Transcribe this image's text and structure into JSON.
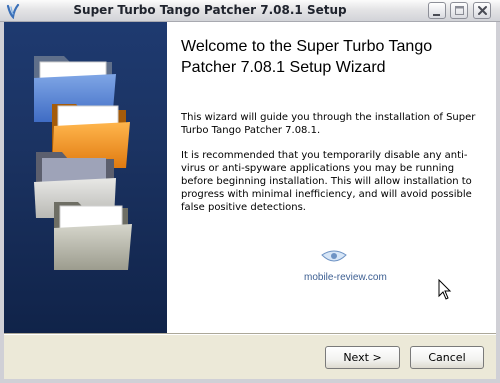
{
  "window": {
    "title": "Super Turbo Tango Patcher 7.08.1 Setup"
  },
  "title_buttons": {
    "minimize": "minimize-icon",
    "maximize": "maximize-icon",
    "close": "close-icon"
  },
  "content": {
    "heading": "Welcome to the Super Turbo Tango Patcher 7.08.1 Setup Wizard",
    "paragraph1": "This wizard will guide you through the installation of Super Turbo Tango Patcher 7.08.1.",
    "paragraph2": "It is recommended that you temporarily disable any anti-virus or anti-spyware applications you may be running before beginning installation. This will allow installation to progress with minimal inefficiency, and will avoid possible false positive detections."
  },
  "watermark": {
    "text": "mobile-review.com"
  },
  "buttons": {
    "next": "Next >",
    "cancel": "Cancel"
  },
  "colors": {
    "sidebar": "#1b3362",
    "title_text": "#20242e",
    "watermark": "#3d5f92"
  }
}
